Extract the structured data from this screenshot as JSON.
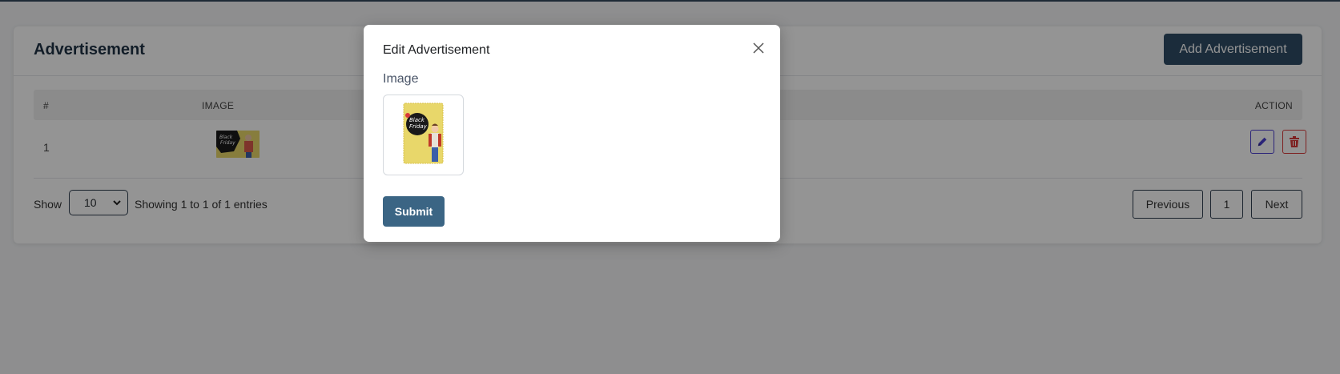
{
  "page": {
    "title": "Advertisement",
    "add_button_label": "Add Advertisement"
  },
  "table": {
    "columns": [
      "#",
      "IMAGE",
      "ACTION"
    ],
    "rows": [
      {
        "index": "1",
        "image": "black-friday-ad-thumbnail",
        "actions": [
          "pencil-icon",
          "trash-icon"
        ]
      }
    ]
  },
  "footer": {
    "show_label": "Show",
    "page_size": "10",
    "entries_text": "Showing 1 to 1 of 1 entries",
    "pagination": {
      "previous": "Previous",
      "current": "1",
      "next": "Next"
    }
  },
  "modal": {
    "title": "Edit Advertisement",
    "image_label": "Image",
    "submit_label": "Submit"
  },
  "colors": {
    "primary": "#2f4d66",
    "submit": "#3b6584",
    "edit_accent": "#4a3fd0",
    "delete_accent": "#d93a3a",
    "ad_yellow": "#e8d76a"
  }
}
